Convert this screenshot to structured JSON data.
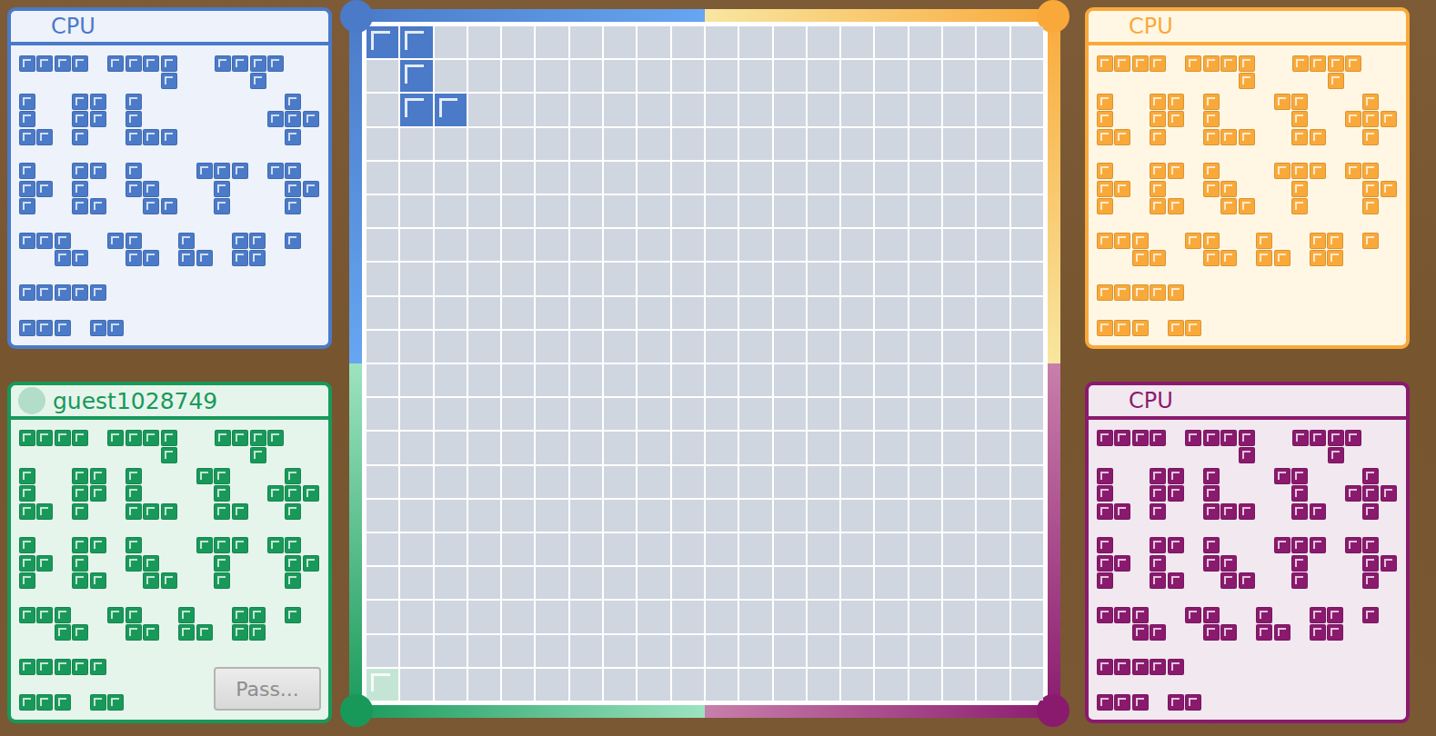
{
  "players": [
    {
      "name": "CPU",
      "color": "#4a7ac8",
      "is_human": false,
      "pieces": [
        {
          "kind": "I4",
          "available": true
        },
        {
          "kind": "L5",
          "available": true
        },
        {
          "kind": "Y5",
          "available": true
        },
        {
          "kind": "L4",
          "available": true
        },
        {
          "kind": "P5",
          "available": true
        },
        {
          "kind": "V5",
          "available": true
        },
        {
          "kind": "Z5",
          "available": false
        },
        {
          "kind": "X5",
          "available": true
        },
        {
          "kind": "T4",
          "available": true
        },
        {
          "kind": "U5",
          "available": true
        },
        {
          "kind": "W5",
          "available": true
        },
        {
          "kind": "T5",
          "available": true
        },
        {
          "kind": "F5",
          "available": true
        },
        {
          "kind": "N5",
          "available": true
        },
        {
          "kind": "Z4",
          "available": true
        },
        {
          "kind": "V3",
          "available": true
        },
        {
          "kind": "O4",
          "available": true
        },
        {
          "kind": "I1",
          "available": true
        },
        {
          "kind": "I5",
          "available": true
        },
        {
          "kind": "I3",
          "available": true
        },
        {
          "kind": "I2",
          "available": true
        }
      ]
    },
    {
      "name": "CPU",
      "color": "#f9a93a",
      "is_human": false,
      "pieces": [
        {
          "kind": "I4",
          "available": true
        },
        {
          "kind": "L5",
          "available": true
        },
        {
          "kind": "Y5",
          "available": true
        },
        {
          "kind": "L4",
          "available": true
        },
        {
          "kind": "P5",
          "available": true
        },
        {
          "kind": "V5",
          "available": true
        },
        {
          "kind": "Z5",
          "available": true
        },
        {
          "kind": "X5",
          "available": true
        },
        {
          "kind": "T4",
          "available": true
        },
        {
          "kind": "U5",
          "available": true
        },
        {
          "kind": "W5",
          "available": true
        },
        {
          "kind": "T5",
          "available": true
        },
        {
          "kind": "F5",
          "available": true
        },
        {
          "kind": "N5",
          "available": true
        },
        {
          "kind": "Z4",
          "available": true
        },
        {
          "kind": "V3",
          "available": true
        },
        {
          "kind": "O4",
          "available": true
        },
        {
          "kind": "I1",
          "available": true
        },
        {
          "kind": "I5",
          "available": true
        },
        {
          "kind": "I3",
          "available": true
        },
        {
          "kind": "I2",
          "available": true
        }
      ]
    },
    {
      "name": "CPU",
      "color": "#8a1a6e",
      "is_human": false,
      "pieces": [
        {
          "kind": "I4",
          "available": true
        },
        {
          "kind": "L5",
          "available": true
        },
        {
          "kind": "Y5",
          "available": true
        },
        {
          "kind": "L4",
          "available": true
        },
        {
          "kind": "P5",
          "available": true
        },
        {
          "kind": "V5",
          "available": true
        },
        {
          "kind": "Z5",
          "available": true
        },
        {
          "kind": "X5",
          "available": true
        },
        {
          "kind": "T4",
          "available": true
        },
        {
          "kind": "U5",
          "available": true
        },
        {
          "kind": "W5",
          "available": true
        },
        {
          "kind": "T5",
          "available": true
        },
        {
          "kind": "F5",
          "available": true
        },
        {
          "kind": "N5",
          "available": true
        },
        {
          "kind": "Z4",
          "available": true
        },
        {
          "kind": "V3",
          "available": true
        },
        {
          "kind": "O4",
          "available": true
        },
        {
          "kind": "I1",
          "available": true
        },
        {
          "kind": "I5",
          "available": true
        },
        {
          "kind": "I3",
          "available": true
        },
        {
          "kind": "I2",
          "available": true
        }
      ]
    },
    {
      "name": "guest1028749",
      "color": "#18995a",
      "is_human": true,
      "pieces": [
        {
          "kind": "I4",
          "available": true
        },
        {
          "kind": "L5",
          "available": true
        },
        {
          "kind": "Y5",
          "available": true
        },
        {
          "kind": "L4",
          "available": true
        },
        {
          "kind": "P5",
          "available": true
        },
        {
          "kind": "V5",
          "available": true
        },
        {
          "kind": "Z5",
          "available": true
        },
        {
          "kind": "X5",
          "available": true
        },
        {
          "kind": "T4",
          "available": true
        },
        {
          "kind": "U5",
          "available": true
        },
        {
          "kind": "W5",
          "available": true
        },
        {
          "kind": "T5",
          "available": true
        },
        {
          "kind": "F5",
          "available": true
        },
        {
          "kind": "N5",
          "available": true
        },
        {
          "kind": "Z4",
          "available": true
        },
        {
          "kind": "V3",
          "available": true
        },
        {
          "kind": "O4",
          "available": true
        },
        {
          "kind": "I1",
          "available": true
        },
        {
          "kind": "I5",
          "available": true
        },
        {
          "kind": "I3",
          "available": true
        },
        {
          "kind": "I2",
          "available": true
        }
      ]
    }
  ],
  "pass_button": {
    "label": "Pass...",
    "disabled": true
  },
  "board": {
    "cells": [
      {
        "row": 0,
        "col": 0,
        "player": 0
      },
      {
        "row": 0,
        "col": 1,
        "player": 0
      },
      {
        "row": 1,
        "col": 1,
        "player": 0
      },
      {
        "row": 2,
        "col": 1,
        "player": 0
      },
      {
        "row": 2,
        "col": 2,
        "player": 0
      }
    ],
    "preview": {
      "row": 19,
      "col": 0,
      "player": 3
    }
  }
}
